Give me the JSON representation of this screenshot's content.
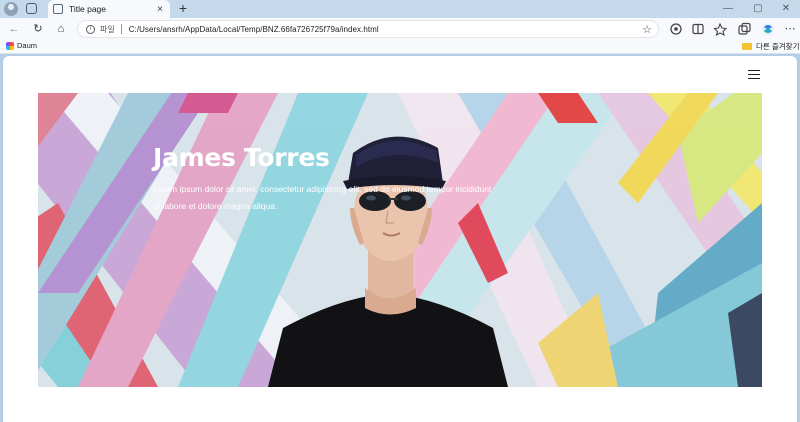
{
  "browser": {
    "tab_title": "Title page",
    "tab_close": "×",
    "new_tab": "+",
    "address_protocol": "파일",
    "address_url": "C:/Users/ansrh/AppData/Local/Temp/BNZ.66fa726725f79a/index.html",
    "star_icon": "☆",
    "minimize": "—",
    "maximize": "▢",
    "close": "✕"
  },
  "bookmarks": {
    "left_item": "Daum",
    "right_item": "다른 즐겨찾기"
  },
  "toolbar": {
    "back": "←",
    "refresh": "↻",
    "home": "⌂",
    "icons": [
      "extensions-icon",
      "split-screen-icon",
      "favorites-icon",
      "collections-icon",
      "copilot-icon"
    ]
  },
  "page": {
    "hero_title": "James Torres",
    "hero_description": "Lorem ipsum dolor sit amet, consectetur adipisicing elit, sed do eiusmod tempor incididunt ut labore et dolore magna aliqua."
  },
  "colors": {
    "accent": "#0078d4",
    "tab_strip": "#c5d9ec",
    "page_background": "#ffffff"
  }
}
